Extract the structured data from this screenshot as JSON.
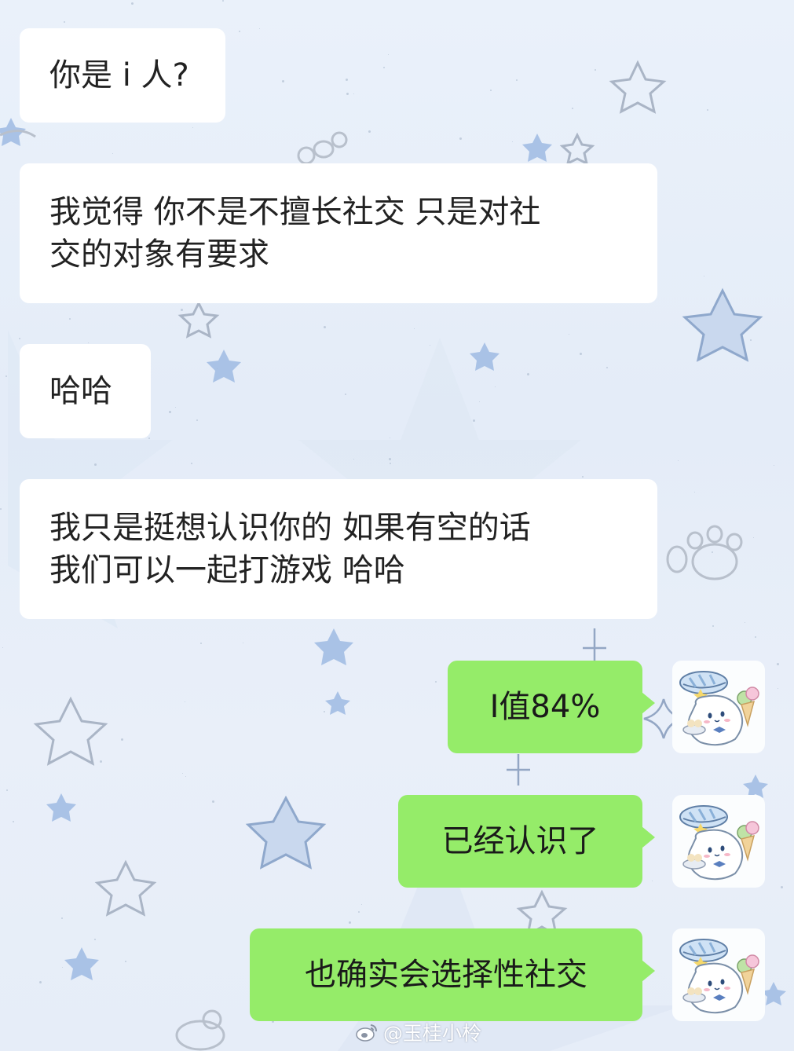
{
  "chat": {
    "incoming": [
      {
        "text": "你是 i 人?"
      },
      {
        "text": "我觉得 你不是不擅长社交 只是对社\n交的对象有要求"
      },
      {
        "text": "哈哈"
      },
      {
        "text": "我只是挺想认识你的 如果有空的话\n我们可以一起打游戏 哈哈"
      }
    ],
    "outgoing": [
      {
        "text": "I值84%"
      },
      {
        "text": "已经认识了"
      },
      {
        "text": "也确实会选择性社交"
      }
    ],
    "self_avatar_icon": "cinnamoroll-sailor-avatar-icon"
  },
  "watermark": {
    "text": "@玉桂小柃",
    "icon": "weibo-logo-icon"
  },
  "colors": {
    "outgoing_bubble": "#95ec69",
    "incoming_bubble": "#ffffff",
    "background": "#e8eef8",
    "star_blue": "#b7cdea"
  }
}
